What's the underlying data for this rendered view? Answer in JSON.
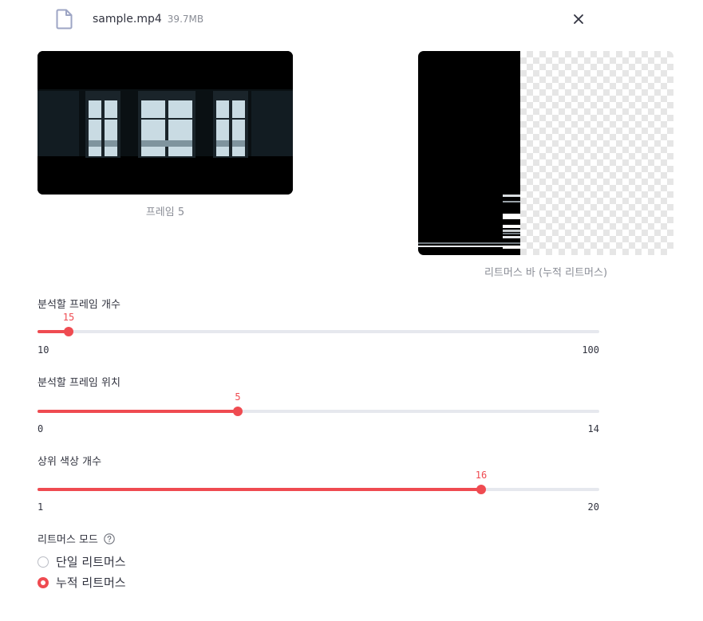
{
  "file": {
    "name": "sample.mp4",
    "size": "39.7MB"
  },
  "frame_preview": {
    "caption": "프레임 5"
  },
  "rhythm_bar": {
    "caption": "리트머스 바 (누적 리트머스)"
  },
  "sliders": [
    {
      "label": "분석할 프레임 개수",
      "value": "15",
      "min": "10",
      "max": "100",
      "fraction": 0.0556
    },
    {
      "label": "분석할 프레임 위치",
      "value": "5",
      "min": "0",
      "max": "14",
      "fraction": 0.3571
    },
    {
      "label": "상위 색상 개수",
      "value": "16",
      "min": "1",
      "max": "20",
      "fraction": 0.7895
    }
  ],
  "mode": {
    "label": "리트머스 모드",
    "options": [
      {
        "label": "단일 리트머스",
        "selected": false
      },
      {
        "label": "누적 리트머스",
        "selected": true
      }
    ]
  },
  "colors": {
    "accent": "#ef4b51",
    "track": "#e6e8ee",
    "muted_text": "#8a8d96"
  },
  "icons": {
    "file": "file-icon",
    "close": "close-icon",
    "help": "help-icon"
  }
}
